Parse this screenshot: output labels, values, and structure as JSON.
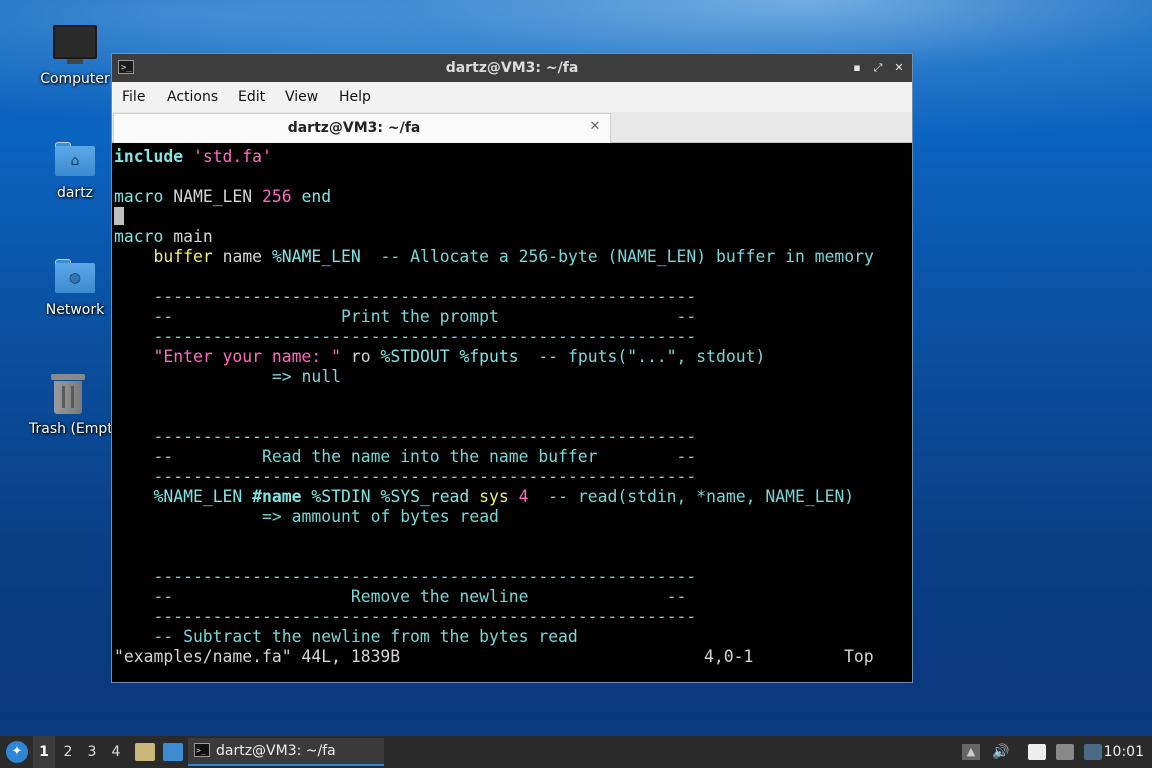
{
  "desktop": {
    "icons": [
      {
        "label": "Computer"
      },
      {
        "label": "dartz"
      },
      {
        "label": "Network"
      },
      {
        "label": "Trash (Empty)"
      }
    ]
  },
  "window": {
    "title": "dartz@VM3: ~/fa",
    "controls": {
      "minimize": "▪",
      "maximize": "⤢",
      "close": "✕"
    },
    "menu": [
      "File",
      "Actions",
      "Edit",
      "View",
      "Help"
    ],
    "tab": {
      "label": "dartz@VM3: ~/fa",
      "close": "✕"
    }
  },
  "editor": {
    "lines": [
      "include 'std.fa'",
      "",
      "macro NAME_LEN 256 end",
      "",
      "macro main",
      "    buffer name %NAME_LEN  -- Allocate a 256-byte (NAME_LEN) buffer in memory",
      "",
      "    -------------------------------------------------------",
      "    --                 Print the prompt                  --",
      "    -------------------------------------------------------",
      "    \"Enter your name: \" ro %STDOUT %fputs  -- fputs(\"...\", stdout)",
      "                => null",
      "",
      "",
      "    -------------------------------------------------------",
      "    --         Read the name into the name buffer        --",
      "    -------------------------------------------------------",
      "    %NAME_LEN #name %STDIN %SYS_read sys 4  -- read(stdin, *name, NAME_LEN)",
      "               => ammount of bytes read",
      "",
      "",
      "    -------------------------------------------------------",
      "    --                  Remove the newline              --",
      "    -------------------------------------------------------",
      "    -- Subtract the newline from the bytes read"
    ],
    "status": {
      "file": "\"examples/name.fa\" 44L, 1839B",
      "position": "4,0-1",
      "scroll": "Top"
    }
  },
  "taskbar": {
    "workspaces": [
      "1",
      "2",
      "3",
      "4"
    ],
    "task": {
      "label": "dartz@VM3: ~/fa"
    },
    "clock": "10:01"
  }
}
